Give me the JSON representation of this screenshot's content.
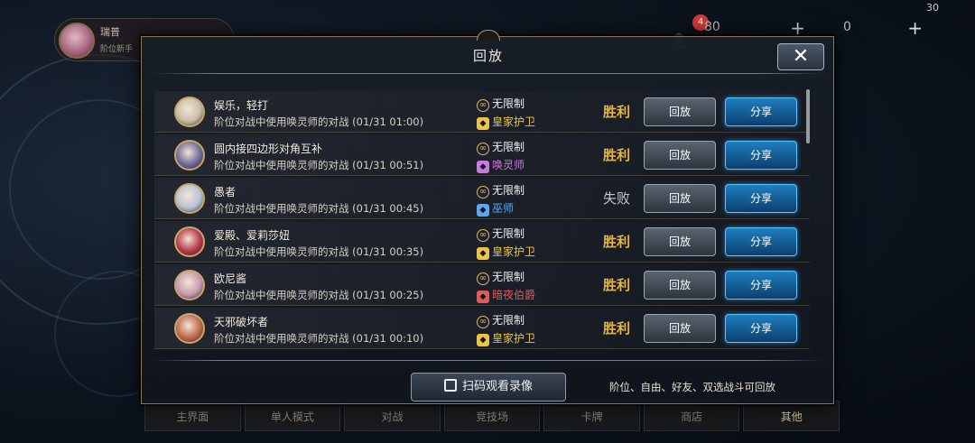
{
  "topbar": {
    "player_name": "瑞普",
    "player_rank": "阶位新手",
    "battery": "30",
    "gold": "80",
    "gems": "0",
    "notification_count": "4"
  },
  "dialog": {
    "title": "回放",
    "close_label": "✕",
    "scan_label": "扫码观看录像",
    "footnote": "阶位、自由、好友、双选战斗可回放"
  },
  "records": [
    {
      "title": "娱乐，轻打",
      "desc": "阶位对战中使用唤灵师的对战 (01/31 01:00)",
      "rule": "无限制",
      "class": "皇家护卫",
      "class_color": "#e9c24a",
      "result": "胜利",
      "win": true,
      "avatar_color": "#c9bfa8"
    },
    {
      "title": "圆内接四边形对角互补",
      "desc": "阶位对战中使用唤灵师的对战 (01/31 00:51)",
      "rule": "无限制",
      "class": "唤灵师",
      "class_color": "#c77ae0",
      "result": "胜利",
      "win": true,
      "avatar_color": "#6d6a9a"
    },
    {
      "title": "愚者",
      "desc": "阶位对战中使用唤灵师的对战 (01/31 00:45)",
      "rule": "无限制",
      "class": "巫师",
      "class_color": "#5aa8f0",
      "result": "失败",
      "win": false,
      "avatar_color": "#b7c4d6"
    },
    {
      "title": "爱殿、爱莉莎妞",
      "desc": "阶位对战中使用唤灵师的对战 (01/31 00:35)",
      "rule": "无限制",
      "class": "皇家护卫",
      "class_color": "#e9c24a",
      "result": "胜利",
      "win": true,
      "avatar_color": "#b5394a"
    },
    {
      "title": "欧尼酱",
      "desc": "阶位对战中使用唤灵师的对战 (01/31 00:25)",
      "rule": "无限制",
      "class": "暗夜伯爵",
      "class_color": "#e05a5a",
      "result": "胜利",
      "win": true,
      "avatar_color": "#c79ab0"
    },
    {
      "title": "天邪破坏者",
      "desc": "阶位对战中使用唤灵师的对战 (01/31 00:10)",
      "rule": "无限制",
      "class": "皇家护卫",
      "class_color": "#e9c24a",
      "result": "胜利",
      "win": true,
      "avatar_color": "#c06a4a"
    }
  ],
  "buttons": {
    "replay": "回放",
    "share": "分享"
  },
  "bottom_nav": [
    "主界面",
    "单人模式",
    "对战",
    "竞技场",
    "卡牌",
    "商店",
    "其他"
  ]
}
